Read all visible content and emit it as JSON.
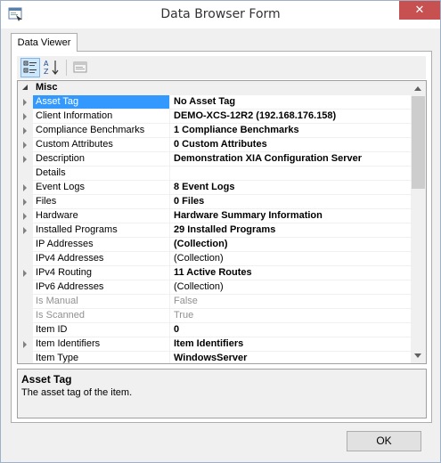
{
  "window": {
    "title": "Data Browser Form",
    "close_label": "✕",
    "icon": "form-icon",
    "accent_close": "#c75050"
  },
  "tabs": [
    {
      "label": "Data Viewer",
      "selected": true
    }
  ],
  "toolbar": {
    "buttons": [
      {
        "icon": "categorized-icon",
        "active": true
      },
      {
        "icon": "alphabetical-sort-icon",
        "active": false
      },
      {
        "icon": "property-pages-icon",
        "active": false
      }
    ]
  },
  "property_grid": {
    "category": "Misc",
    "rows": [
      {
        "name": "Asset Tag",
        "value": "No Asset Tag",
        "expandable": true,
        "bold": true,
        "gray": false,
        "selected": true
      },
      {
        "name": "Client Information",
        "value": "DEMO-XCS-12R2 (192.168.176.158)",
        "expandable": true,
        "bold": true,
        "gray": false,
        "selected": false
      },
      {
        "name": "Compliance Benchmarks",
        "value": "1 Compliance Benchmarks",
        "expandable": true,
        "bold": true,
        "gray": false,
        "selected": false
      },
      {
        "name": "Custom Attributes",
        "value": "0 Custom Attributes",
        "expandable": true,
        "bold": true,
        "gray": false,
        "selected": false
      },
      {
        "name": "Description",
        "value": "Demonstration XIA Configuration Server",
        "expandable": true,
        "bold": true,
        "gray": false,
        "selected": false
      },
      {
        "name": "Details",
        "value": "",
        "expandable": false,
        "bold": false,
        "gray": false,
        "selected": false
      },
      {
        "name": "Event Logs",
        "value": "8 Event Logs",
        "expandable": true,
        "bold": true,
        "gray": false,
        "selected": false
      },
      {
        "name": "Files",
        "value": "0 Files",
        "expandable": true,
        "bold": true,
        "gray": false,
        "selected": false
      },
      {
        "name": "Hardware",
        "value": "Hardware Summary Information",
        "expandable": true,
        "bold": true,
        "gray": false,
        "selected": false
      },
      {
        "name": "Installed Programs",
        "value": "29 Installed Programs",
        "expandable": true,
        "bold": true,
        "gray": false,
        "selected": false
      },
      {
        "name": "IP Addresses",
        "value": "(Collection)",
        "expandable": false,
        "bold": true,
        "gray": false,
        "selected": false
      },
      {
        "name": "IPv4 Addresses",
        "value": "(Collection)",
        "expandable": false,
        "bold": false,
        "gray": false,
        "selected": false
      },
      {
        "name": "IPv4 Routing",
        "value": "11 Active Routes",
        "expandable": true,
        "bold": true,
        "gray": false,
        "selected": false
      },
      {
        "name": "IPv6 Addresses",
        "value": "(Collection)",
        "expandable": false,
        "bold": false,
        "gray": false,
        "selected": false
      },
      {
        "name": "Is Manual",
        "value": "False",
        "expandable": false,
        "bold": false,
        "gray": true,
        "selected": false
      },
      {
        "name": "Is Scanned",
        "value": "True",
        "expandable": false,
        "bold": false,
        "gray": true,
        "selected": false
      },
      {
        "name": "Item ID",
        "value": "0",
        "expandable": false,
        "bold": true,
        "gray": false,
        "selected": false
      },
      {
        "name": "Item Identifiers",
        "value": "Item Identifiers",
        "expandable": true,
        "bold": true,
        "gray": false,
        "selected": false
      },
      {
        "name": "Item Type",
        "value": "WindowsServer",
        "expandable": false,
        "bold": true,
        "gray": false,
        "selected": false
      }
    ]
  },
  "help": {
    "title": "Asset Tag",
    "description": "The asset tag of the item."
  },
  "buttons": {
    "ok_label": "OK"
  }
}
